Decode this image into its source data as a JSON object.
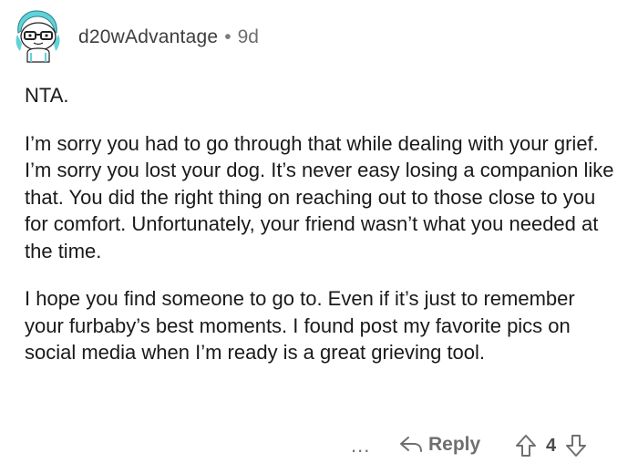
{
  "comment": {
    "username": "d20wAdvantage",
    "separator": "•",
    "age": "9d",
    "paragraphs": [
      "NTA.",
      "I’m sorry you had to go through that while dealing with your grief. I’m sorry you lost your dog. It’s never easy losing a companion like that. You did the right thing on reaching out to those close to you for comfort. Unfortunately, your friend wasn’t what you needed at the time.",
      "I hope you find someone to go to. Even if it’s just to remember your furbaby’s best moments. I found post my favorite pics on social media when I’m ready is a great grieving tool."
    ]
  },
  "actions": {
    "more_label": "...",
    "reply_label": "Reply",
    "vote_count": "4"
  },
  "icons": {
    "avatar": "snoo-avatar-icon",
    "reply": "reply-arrow-icon",
    "upvote": "upvote-arrow-icon",
    "downvote": "downvote-arrow-icon"
  },
  "colors": {
    "text": "#1a1a1b",
    "meta": "#6f6f6f",
    "avatar_accent": "#5fd3d9"
  }
}
